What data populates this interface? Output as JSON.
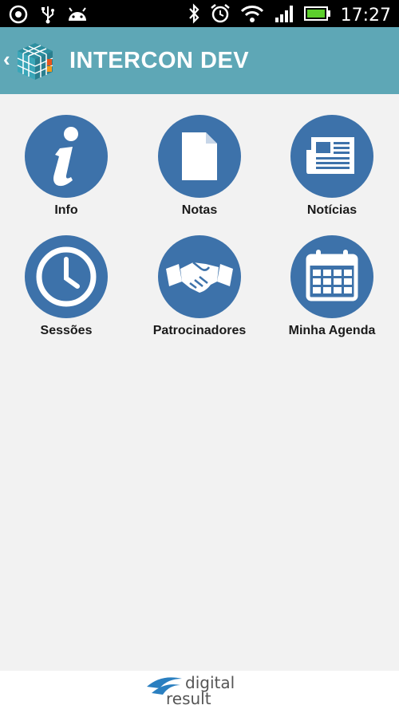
{
  "status_bar": {
    "time": "17:27",
    "icons": [
      "vpn-icon",
      "usb-icon",
      "android-icon",
      "bluetooth-icon",
      "alarm-icon",
      "wifi-icon",
      "signal-icon",
      "battery-icon"
    ]
  },
  "app_bar": {
    "title": "INTERCON DEV",
    "back_icon": "chevron-left-icon",
    "logo_icon": "cube-logo-icon"
  },
  "menu": {
    "items": [
      {
        "label": "Info",
        "icon": "info-icon"
      },
      {
        "label": "Notas",
        "icon": "document-icon"
      },
      {
        "label": "Notícias",
        "icon": "newspaper-icon"
      },
      {
        "label": "Sessões",
        "icon": "clock-icon"
      },
      {
        "label": "Patrocinadores",
        "icon": "handshake-icon"
      },
      {
        "label": "Minha Agenda",
        "icon": "calendar-icon"
      }
    ]
  },
  "footer": {
    "brand_line1": "digital",
    "brand_line2": "result"
  },
  "colors": {
    "app_bar": "#5ea7b6",
    "icon_circle": "#3d72aa",
    "background": "#f2f2f2"
  }
}
